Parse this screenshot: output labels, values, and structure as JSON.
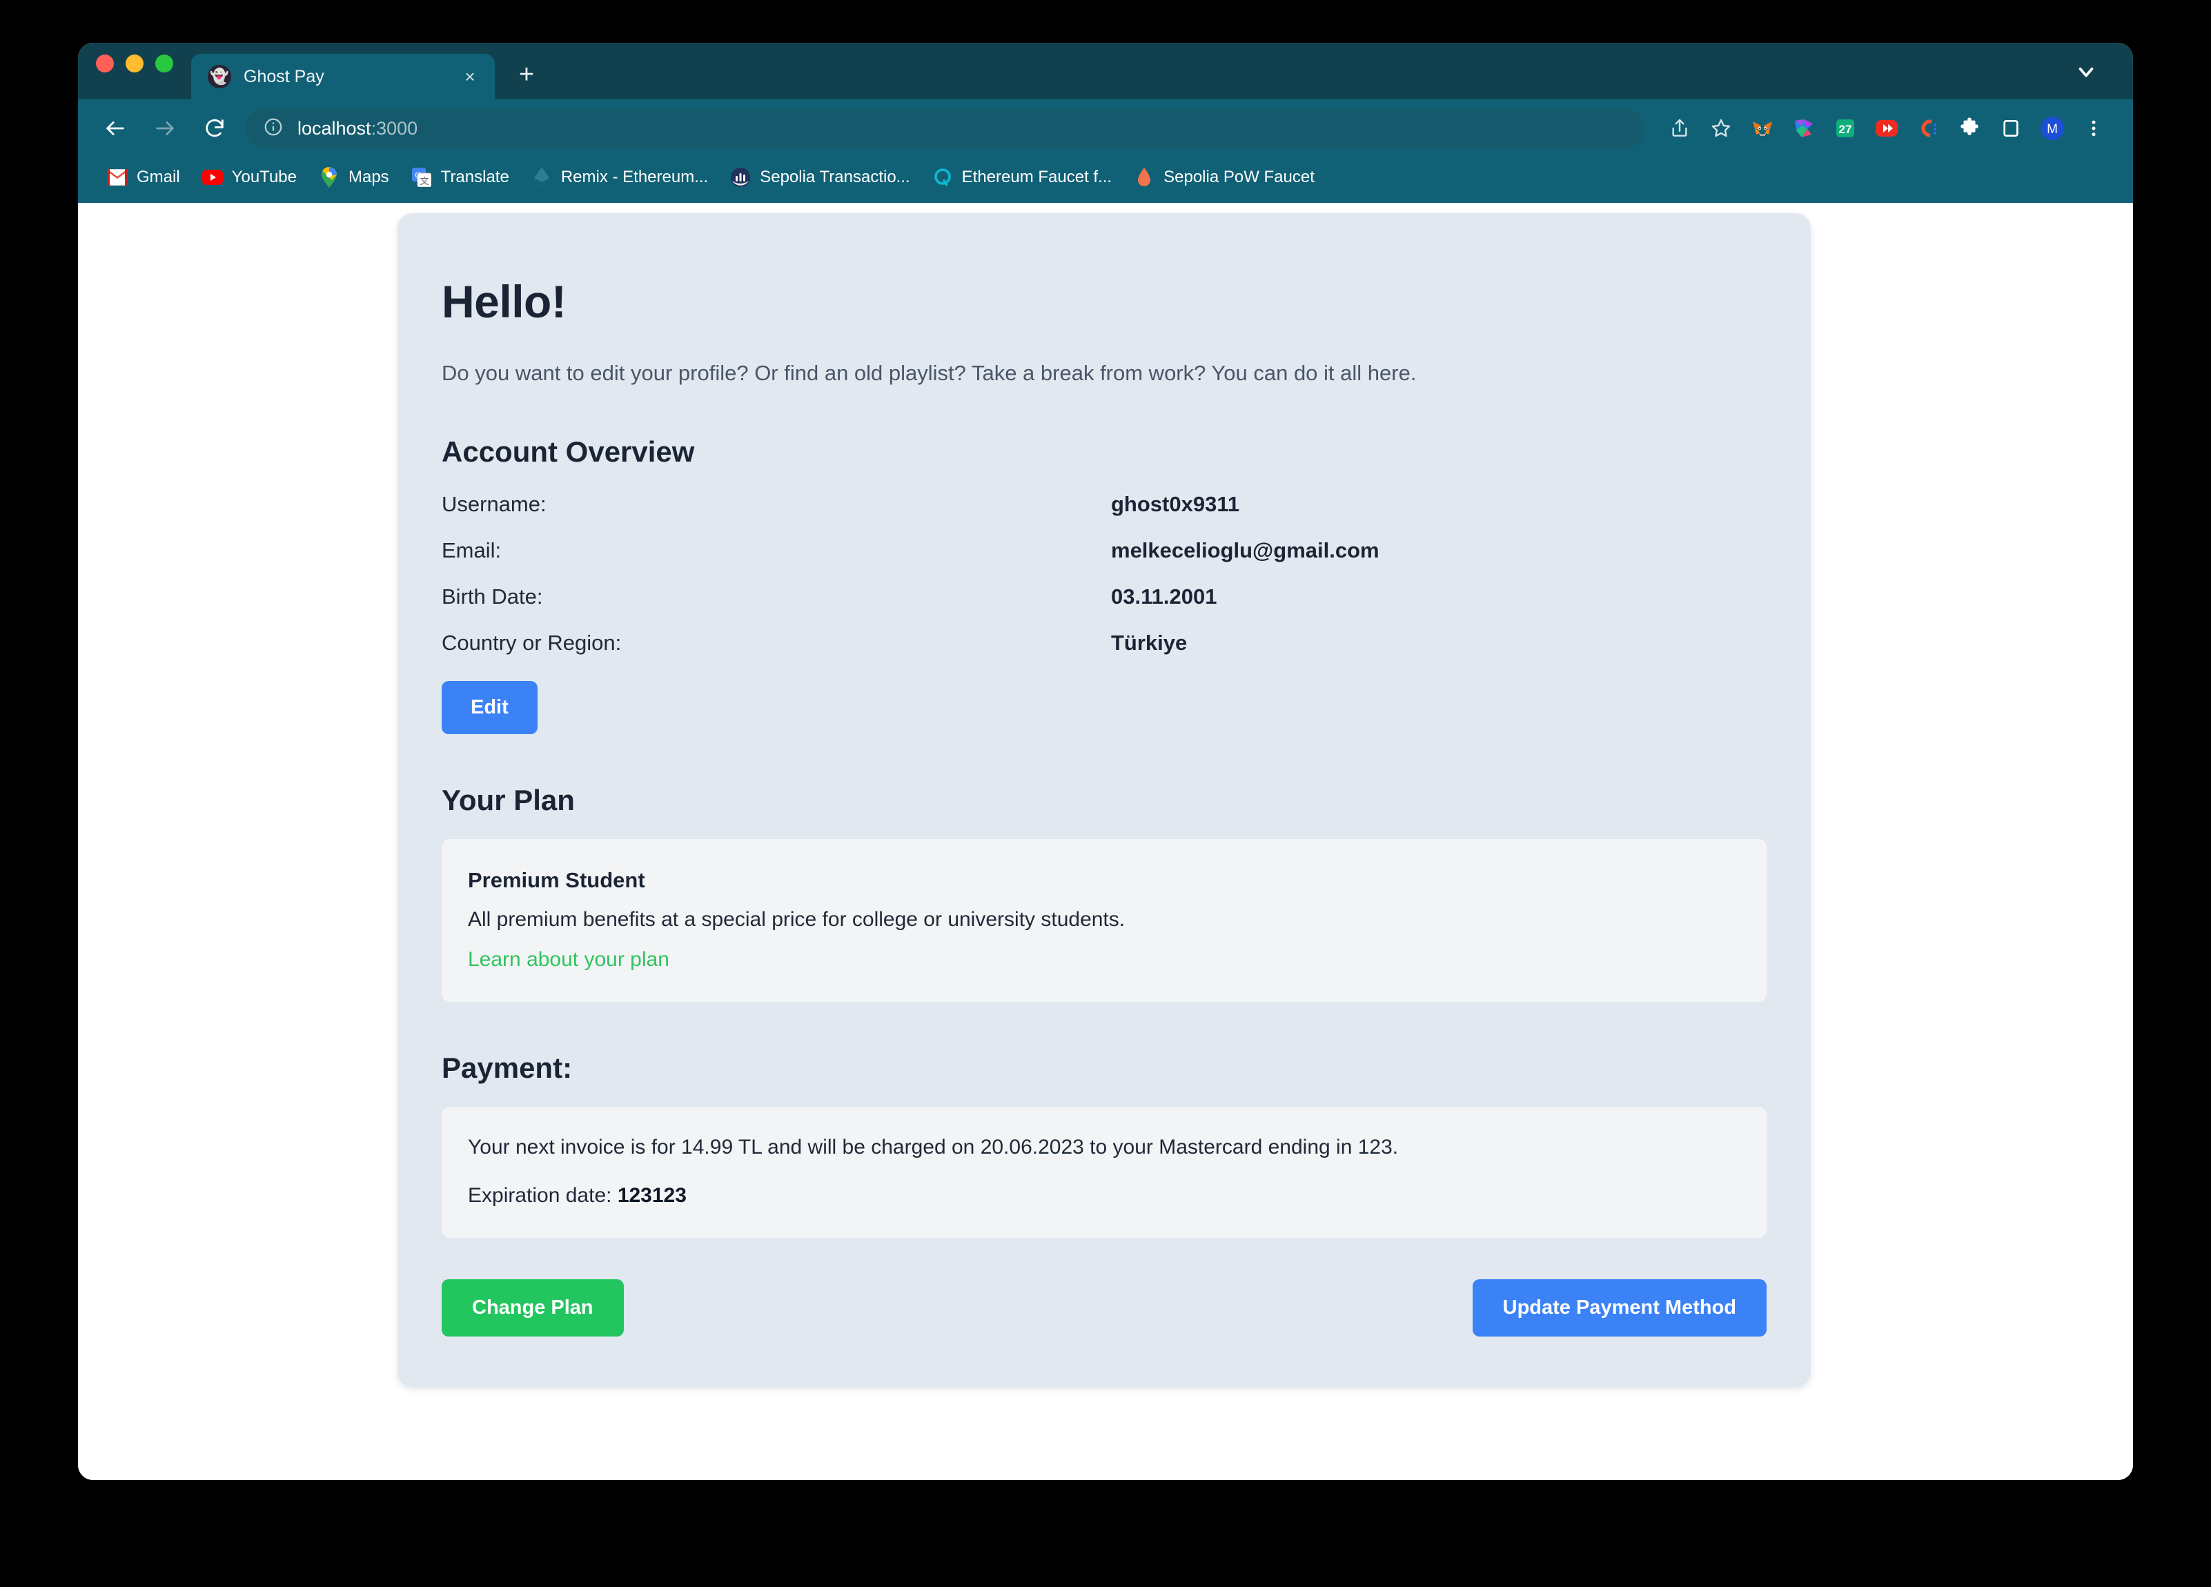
{
  "browser": {
    "tab": {
      "title": "Ghost Pay",
      "favicon": "ghost-icon",
      "close_label": "×"
    },
    "new_tab_label": "+",
    "omnibox": {
      "host": "localhost",
      "port": ":3000",
      "full_url": "localhost:3000",
      "info_icon": "site-info-icon"
    },
    "nav": {
      "back": "back-arrow-icon",
      "forward": "forward-arrow-icon",
      "reload": "reload-icon"
    },
    "toolbar_icons": [
      "share-icon",
      "bookmark-star-icon",
      "metamask-extension-icon",
      "rainbow-extension-icon",
      "calendar-27-extension-icon",
      "youtube-extension-icon",
      "coinbase-extension-icon",
      "extensions-puzzle-icon",
      "side-panel-icon",
      "profile-avatar-m",
      "chrome-menu-icon"
    ],
    "profile_initial": "M",
    "bookmarks": [
      {
        "label": "Gmail",
        "icon": "gmail-icon"
      },
      {
        "label": "YouTube",
        "icon": "youtube-icon"
      },
      {
        "label": "Maps",
        "icon": "google-maps-icon"
      },
      {
        "label": "Translate",
        "icon": "google-translate-icon"
      },
      {
        "label": "Remix - Ethereum...",
        "icon": "remix-icon"
      },
      {
        "label": "Sepolia Transactio...",
        "icon": "etherscan-icon"
      },
      {
        "label": "Ethereum Faucet f...",
        "icon": "quicknode-icon"
      },
      {
        "label": "Sepolia PoW Faucet",
        "icon": "flame-drop-icon"
      }
    ],
    "window_caret": "chevron-down-icon"
  },
  "app": {
    "title": "Hello!",
    "subtitle": "Do you want to edit your profile? Or find an old playlist? Take a break from work? You can do it all here.",
    "account": {
      "heading": "Account Overview",
      "rows": [
        {
          "label": "Username:",
          "value": "ghost0x9311"
        },
        {
          "label": "Email:",
          "value": "melkecelioglu@gmail.com"
        },
        {
          "label": "Birth Date:",
          "value": "03.11.2001"
        },
        {
          "label": "Country or Region:",
          "value": "Türkiye"
        }
      ],
      "edit_label": "Edit"
    },
    "plan": {
      "heading": "Your Plan",
      "name": "Premium Student",
      "description": "All premium benefits at a special price for college or university students.",
      "link_label": "Learn about your plan"
    },
    "payment": {
      "heading": "Payment:",
      "invoice_text": "Your next invoice is for 14.99 TL and will be charged on 20.06.2023 to your Mastercard ending in 123.",
      "expiration_label": "Expiration date:",
      "expiration_value": "123123"
    },
    "actions": {
      "change_plan_label": "Change Plan",
      "update_payment_label": "Update Payment Method"
    },
    "colors": {
      "card_bg": "#e2e8f0",
      "panel_bg": "#f3f4f6",
      "primary_blue": "#3b82f6",
      "success_green": "#22c55e",
      "link_green": "#2ec45e",
      "heading": "#1b2434",
      "browser_chrome": "#106176",
      "browser_tabstrip": "#11414f"
    }
  }
}
